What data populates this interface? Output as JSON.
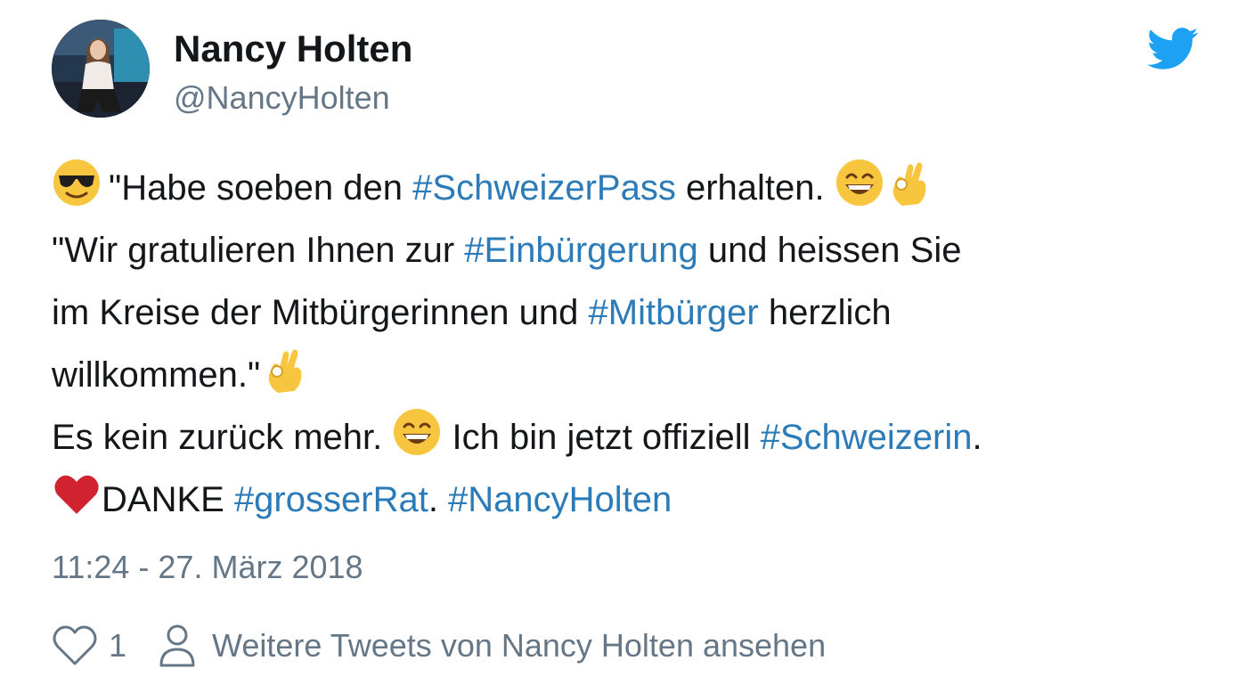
{
  "author": {
    "name": "Nancy Holten",
    "handle": "@NancyHolten"
  },
  "tweet": {
    "line1": {
      "text_a": "\"Habe soeben den ",
      "tag_a": "#SchweizerPass",
      "text_b": " erhalten. "
    },
    "line2": {
      "text_a": "\"Wir gratulieren Ihnen zur ",
      "tag_a": "#Einbürgerung",
      "text_b": " und heissen Sie"
    },
    "line3": {
      "text_a": "im Kreise der Mitbürgerinnen und ",
      "tag_a": "#Mitbürger",
      "text_b": " herzlich"
    },
    "line4": {
      "text_a": "willkommen.\""
    },
    "line5": {
      "text_a": "Es kein zurück mehr. ",
      "text_b": " Ich bin jetzt offiziell ",
      "tag_a": "#Schweizerin",
      "text_c": "."
    },
    "line6": {
      "text_a": "DANKE ",
      "tag_a": "#grosserRat",
      "text_b": ". ",
      "tag_b": "#NancyHolten"
    }
  },
  "timestamp": "11:24 - 27. März 2018",
  "footer": {
    "like_count": "1",
    "more_tweets_label": "Weitere Tweets von Nancy Holten ansehen"
  },
  "icons": {
    "bird": "twitter-bird-icon",
    "heart": "heart-outline-icon",
    "person": "person-outline-icon",
    "emoji_sunglasses": "smiling-face-with-sunglasses-emoji",
    "emoji_grin": "grinning-face-with-smiling-eyes-emoji",
    "emoji_ok": "ok-hand-emoji",
    "emoji_heart": "red-heart-emoji"
  },
  "colors": {
    "hashtag": "#2b7bb9",
    "muted": "#657786",
    "twitter_blue": "#1da1f2",
    "text": "#14171a"
  }
}
